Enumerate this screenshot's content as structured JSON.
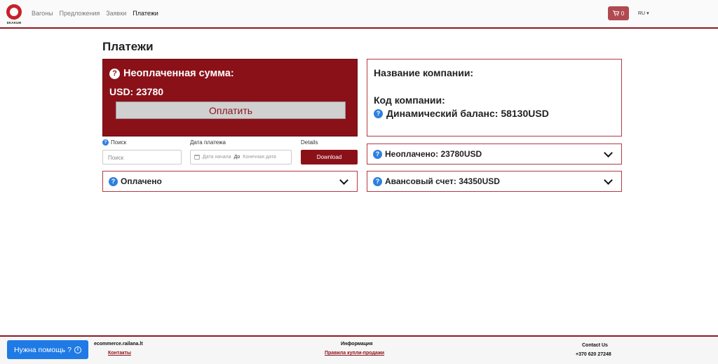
{
  "brand": {
    "logo_text": "EKAKUM"
  },
  "nav": {
    "items": [
      {
        "label": "Вагоны"
      },
      {
        "label": "Предложения"
      },
      {
        "label": "Заявки"
      },
      {
        "label": "Платежи"
      }
    ],
    "cart_count": "0",
    "cart_icon": "cart-icon",
    "language": "RU"
  },
  "page": {
    "title": "Платежи"
  },
  "unpaid": {
    "heading": "Неоплаченная сумма:",
    "amount": "USD: 23780",
    "pay_label": "Оплатить"
  },
  "company": {
    "name_label": "Название компании:",
    "code_label": "Код компании:",
    "dynamic_balance": "Динамический баланс: 58130USD"
  },
  "filters": {
    "search_label": "Поиск",
    "search_placeholder": "Поиск",
    "date_label": "Дата платежа",
    "date_start_placeholder": "Дата начала",
    "date_separator": "До",
    "date_end_placeholder": "Конечная дата",
    "details_label": "Details",
    "download_label": "Download"
  },
  "accordions": {
    "paid": "Оплачено",
    "unpaid": "Неоплачено: 23780USD",
    "advance": "Авансовый счет: 34350USD"
  },
  "footer": {
    "help_label": "Нужна помощь ?",
    "site": "ecommerce.railana.lt",
    "contacts_link": "Контакты",
    "info_heading": "Информация",
    "rules_link": "Правила купли-продажи",
    "contact_heading": "Contact Us",
    "phone": "+370 620 27248"
  },
  "colors": {
    "brand_dark_red": "#8b1119",
    "accent_blue": "#2f7fe0",
    "help_blue": "#1f7ae6"
  }
}
